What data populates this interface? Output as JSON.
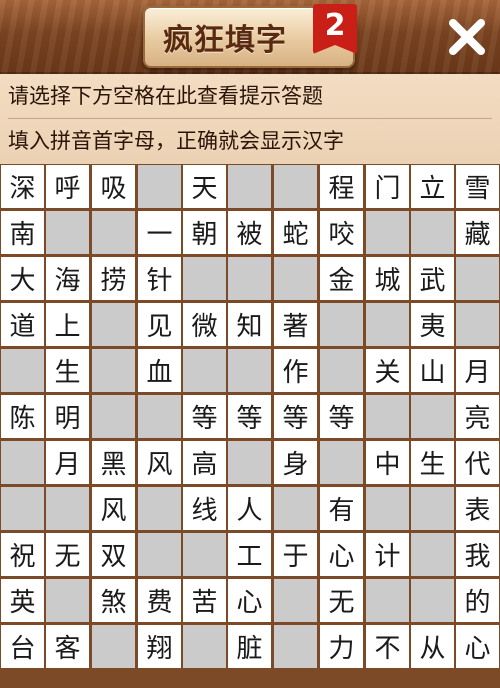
{
  "header": {
    "title": "疯狂填字",
    "badge": "2",
    "close_icon": "close-icon"
  },
  "hints": {
    "line1": "请选择下方空格在此查看提示答题",
    "line2": "填入拼音首字母，正确就会显示汉字"
  },
  "colors": {
    "header_wood": "#7b4421",
    "panel": "#f0d6b8",
    "grid_line": "#7c4a26",
    "empty_cell": "#ffffff",
    "blocked_cell": "#cbcbcb",
    "badge_red": "#c91f16"
  },
  "grid": [
    [
      "深",
      "呼",
      "吸",
      "#",
      "天",
      "#",
      "#",
      "程",
      "门",
      "立",
      "雪"
    ],
    [
      "南",
      "#",
      "#",
      "一",
      "朝",
      "被",
      "蛇",
      "咬",
      "#",
      "#",
      "藏"
    ],
    [
      "大",
      "海",
      "捞",
      "针",
      "#",
      "#",
      "#",
      "金",
      "城",
      "武",
      "#"
    ],
    [
      "道",
      "上",
      "#",
      "见",
      "微",
      "知",
      "著",
      "#",
      "#",
      "夷",
      "#"
    ],
    [
      "#",
      "生",
      "#",
      "血",
      "#",
      "#",
      "作",
      "#",
      "关",
      "山",
      "月"
    ],
    [
      "陈",
      "明",
      "#",
      "#",
      "等",
      "等",
      "等",
      "等",
      "#",
      "#",
      "亮"
    ],
    [
      "#",
      "月",
      "黑",
      "风",
      "高",
      "#",
      "身",
      "#",
      "中",
      "生",
      "代"
    ],
    [
      "#",
      "#",
      "风",
      "#",
      "线",
      "人",
      "#",
      "有",
      "#",
      "#",
      "表"
    ],
    [
      "祝",
      "无",
      "双",
      "#",
      "#",
      "工",
      "于",
      "心",
      "计",
      "#",
      "我"
    ],
    [
      "英",
      "#",
      "煞",
      "费",
      "苦",
      "心",
      "#",
      "无",
      "#",
      "#",
      "的"
    ],
    [
      "台",
      "客",
      "#",
      "翔",
      "#",
      "脏",
      "#",
      "力",
      "不",
      "从",
      "心"
    ]
  ]
}
